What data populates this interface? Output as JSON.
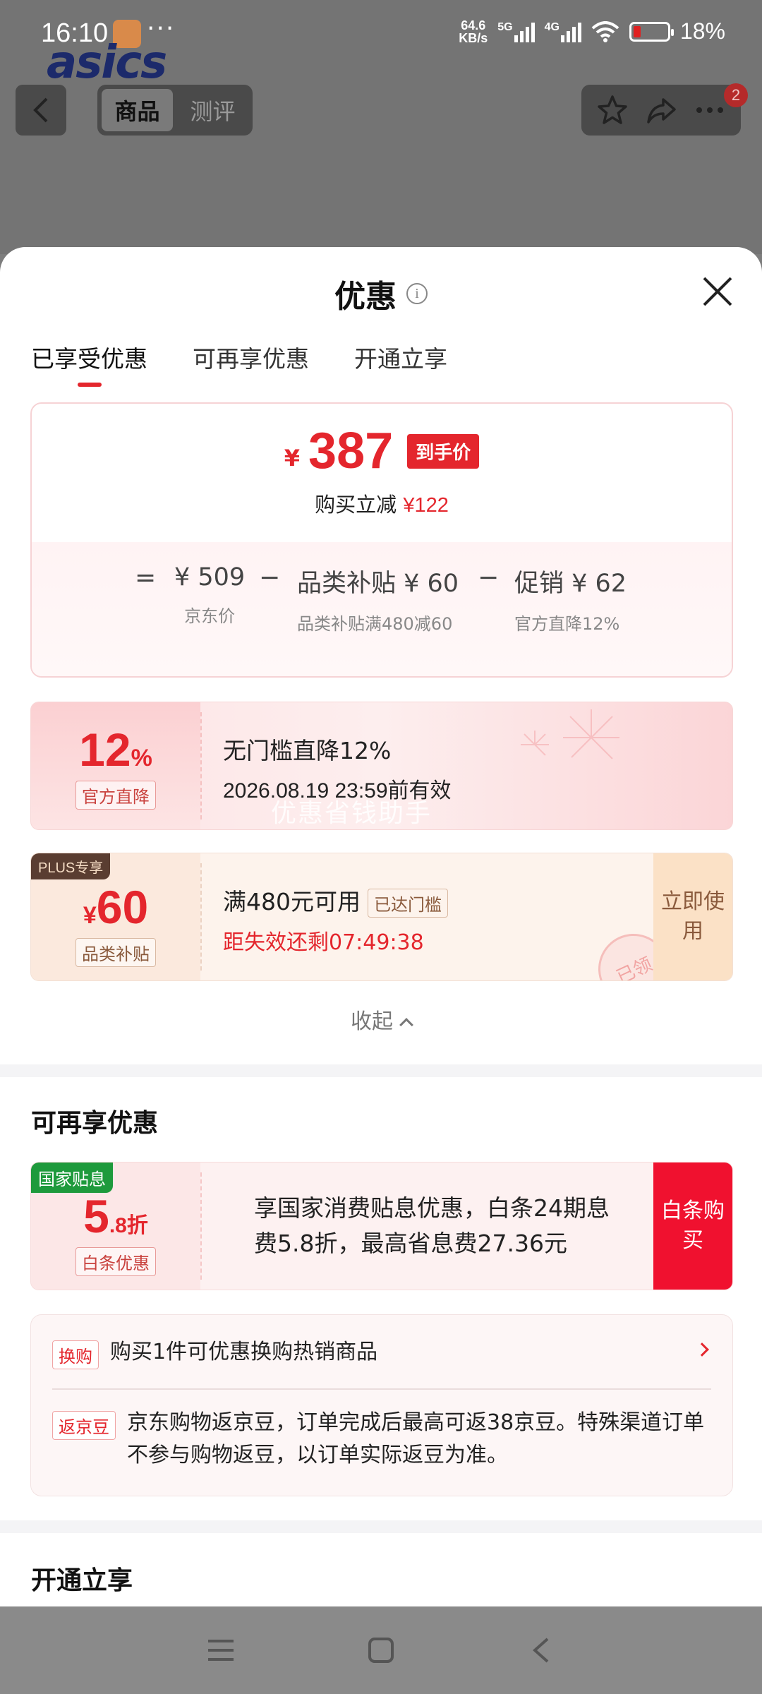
{
  "status_bar": {
    "time": "16:10",
    "dots": "···",
    "net_speed_value": "64.6",
    "net_speed_unit": "KB/s",
    "signal1": "5G",
    "signal2": "4G",
    "battery": "18%"
  },
  "brand": {
    "logo_text": "asics"
  },
  "top_nav": {
    "tabs": [
      {
        "label": "商品"
      },
      {
        "label": "测评"
      }
    ],
    "badge_count": "2",
    "icons": [
      "back-icon",
      "star-icon",
      "share-icon",
      "more-icon"
    ]
  },
  "sheet": {
    "title": "优惠",
    "info_icon": "i",
    "tabs": [
      {
        "label": "已享受优惠"
      },
      {
        "label": "可再享优惠"
      },
      {
        "label": "开通立享"
      }
    ],
    "price_summary": {
      "currency": "¥",
      "final_price": "387",
      "final_label": "到手价",
      "discount_prefix": "购买立减",
      "discount_amount": "¥122",
      "formula": [
        {
          "op": "=",
          "main": "¥ 509",
          "sub": "京东价"
        },
        {
          "op": "−",
          "main": "品类补贴 ¥ 60",
          "sub": "品类补贴满480减60"
        },
        {
          "op": "−",
          "main": "促销 ¥ 62",
          "sub": "官方直降12%"
        }
      ]
    },
    "coupon_official": {
      "value_num": "12",
      "value_unit": "%",
      "label": "官方直降",
      "title": "无门槛直降12%",
      "validity": "2026.08.19 23:59前有效",
      "watermark": "优惠省钱助手"
    },
    "coupon_plus": {
      "tag": "PLUS专享",
      "currency": "¥",
      "value": "60",
      "label": "品类补贴",
      "title": "满480元可用",
      "threshold_tag": "已达门槛",
      "countdown": "距失效还剩07:49:38",
      "action": "立即使用",
      "stamp": "已领"
    },
    "collapse_label": "收起",
    "section_more": {
      "title": "可再享优惠",
      "coupon_gov": {
        "tag": "国家贴息",
        "value_big": "5",
        "value_small": ".8折",
        "label": "白条优惠",
        "desc": "享国家消费贴息优惠，白条24期息费5.8折，最高省息费27.36元",
        "action": "白条购买"
      },
      "benefits": [
        {
          "tag": "换购",
          "text": "购买1件可优惠换购热销商品"
        },
        {
          "tag": "返京豆",
          "text": "京东购物返京豆，订单完成后最高可返38京豆。特殊渠道订单不参与购物返豆，以订单实际返豆为准。"
        }
      ]
    },
    "section_open": {
      "title": "开通立享"
    }
  },
  "colors": {
    "accent": "#e4262d",
    "plus_bg": "#5a3d31",
    "gov_green": "#1e9a3c"
  }
}
